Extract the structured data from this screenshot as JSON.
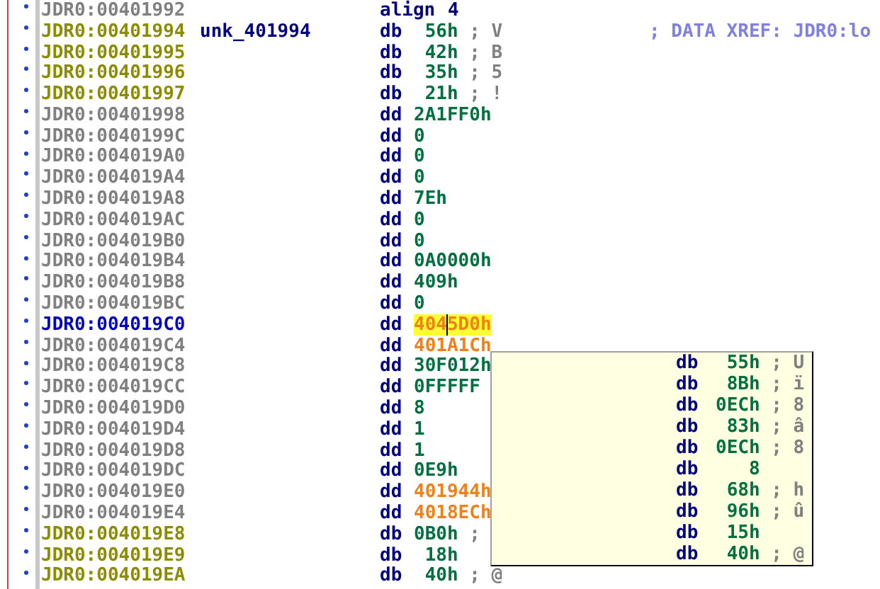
{
  "listing": {
    "rows": [
      {
        "address": "JDR0:00401992",
        "kind": "directive",
        "current": false,
        "mnemonic": "align",
        "operand": "4"
      },
      {
        "address": "JDR0:00401994",
        "kind": "byte",
        "current": false,
        "label": "unk_401994",
        "mnemonic": "db",
        "operand": "56h",
        "offset": false,
        "comment": "; V",
        "xref": "; DATA XREF: JDR0:lo"
      },
      {
        "address": "JDR0:00401995",
        "kind": "byte",
        "current": false,
        "mnemonic": "db",
        "operand": "42h",
        "offset": false,
        "comment": "; B"
      },
      {
        "address": "JDR0:00401996",
        "kind": "byte",
        "current": false,
        "mnemonic": "db",
        "operand": "35h",
        "offset": false,
        "comment": "; 5"
      },
      {
        "address": "JDR0:00401997",
        "kind": "byte",
        "current": false,
        "mnemonic": "db",
        "operand": "21h",
        "offset": false,
        "comment": "; !"
      },
      {
        "address": "JDR0:00401998",
        "kind": "dword",
        "current": false,
        "mnemonic": "dd",
        "operand": "2A1FF0h",
        "offset": false
      },
      {
        "address": "JDR0:0040199C",
        "kind": "dword",
        "current": false,
        "mnemonic": "dd",
        "operand": "0",
        "offset": false
      },
      {
        "address": "JDR0:004019A0",
        "kind": "dword",
        "current": false,
        "mnemonic": "dd",
        "operand": "0",
        "offset": false
      },
      {
        "address": "JDR0:004019A4",
        "kind": "dword",
        "current": false,
        "mnemonic": "dd",
        "operand": "0",
        "offset": false
      },
      {
        "address": "JDR0:004019A8",
        "kind": "dword",
        "current": false,
        "mnemonic": "dd",
        "operand": "7Eh",
        "offset": false
      },
      {
        "address": "JDR0:004019AC",
        "kind": "dword",
        "current": false,
        "mnemonic": "dd",
        "operand": "0",
        "offset": false
      },
      {
        "address": "JDR0:004019B0",
        "kind": "dword",
        "current": false,
        "mnemonic": "dd",
        "operand": "0",
        "offset": false
      },
      {
        "address": "JDR0:004019B4",
        "kind": "dword",
        "current": false,
        "mnemonic": "dd",
        "operand": "0A0000h",
        "offset": false
      },
      {
        "address": "JDR0:004019B8",
        "kind": "dword",
        "current": false,
        "mnemonic": "dd",
        "operand": "409h",
        "offset": false
      },
      {
        "address": "JDR0:004019BC",
        "kind": "dword",
        "current": false,
        "mnemonic": "dd",
        "operand": "0",
        "offset": false
      },
      {
        "address": "JDR0:004019C0",
        "kind": "dword",
        "current": true,
        "mnemonic": "dd",
        "operand": "4045D0h",
        "offset": true,
        "highlighted": true
      },
      {
        "address": "JDR0:004019C4",
        "kind": "dword",
        "current": false,
        "mnemonic": "dd",
        "operand": "401A1Ch",
        "offset": true
      },
      {
        "address": "JDR0:004019C8",
        "kind": "dword",
        "current": false,
        "mnemonic": "dd",
        "operand": "30F012h",
        "offset": false
      },
      {
        "address": "JDR0:004019CC",
        "kind": "dword",
        "current": false,
        "mnemonic": "dd",
        "operand": "0FFFFF",
        "offset": false
      },
      {
        "address": "JDR0:004019D0",
        "kind": "dword",
        "current": false,
        "mnemonic": "dd",
        "operand": "8",
        "offset": false
      },
      {
        "address": "JDR0:004019D4",
        "kind": "dword",
        "current": false,
        "mnemonic": "dd",
        "operand": "1",
        "offset": false
      },
      {
        "address": "JDR0:004019D8",
        "kind": "dword",
        "current": false,
        "mnemonic": "dd",
        "operand": "1",
        "offset": false
      },
      {
        "address": "JDR0:004019DC",
        "kind": "dword",
        "current": false,
        "mnemonic": "dd",
        "operand": "0E9h",
        "offset": false
      },
      {
        "address": "JDR0:004019E0",
        "kind": "dword",
        "current": false,
        "mnemonic": "dd",
        "operand": "401944h",
        "offset": true
      },
      {
        "address": "JDR0:004019E4",
        "kind": "dword",
        "current": false,
        "mnemonic": "dd",
        "operand": "4018ECh",
        "offset": true
      },
      {
        "address": "JDR0:004019E8",
        "kind": "byte",
        "current": false,
        "mnemonic": "db",
        "operand": "0B0h",
        "offset": false,
        "comment": ";"
      },
      {
        "address": "JDR0:004019E9",
        "kind": "byte",
        "current": false,
        "mnemonic": "db",
        "operand": "18h",
        "offset": false
      },
      {
        "address": "JDR0:004019EA",
        "kind": "byte",
        "current": false,
        "mnemonic": "db",
        "operand": "40h",
        "offset": false,
        "comment": "; @"
      }
    ]
  },
  "tooltip": {
    "rows": [
      {
        "mnemonic": "db",
        "operand": "55h",
        "comment": "; U"
      },
      {
        "mnemonic": "db",
        "operand": "8Bh",
        "comment": "; ï"
      },
      {
        "mnemonic": "db",
        "operand": "0ECh",
        "comment": "; 8"
      },
      {
        "mnemonic": "db",
        "operand": "83h",
        "comment": "; â"
      },
      {
        "mnemonic": "db",
        "operand": "0ECh",
        "comment": "; 8"
      },
      {
        "mnemonic": "db",
        "operand": "8"
      },
      {
        "mnemonic": "db",
        "operand": "68h",
        "comment": "; h"
      },
      {
        "mnemonic": "db",
        "operand": "96h",
        "comment": "; û"
      },
      {
        "mnemonic": "db",
        "operand": "15h"
      },
      {
        "mnemonic": "db",
        "operand": "40h",
        "comment": "; @"
      }
    ]
  }
}
